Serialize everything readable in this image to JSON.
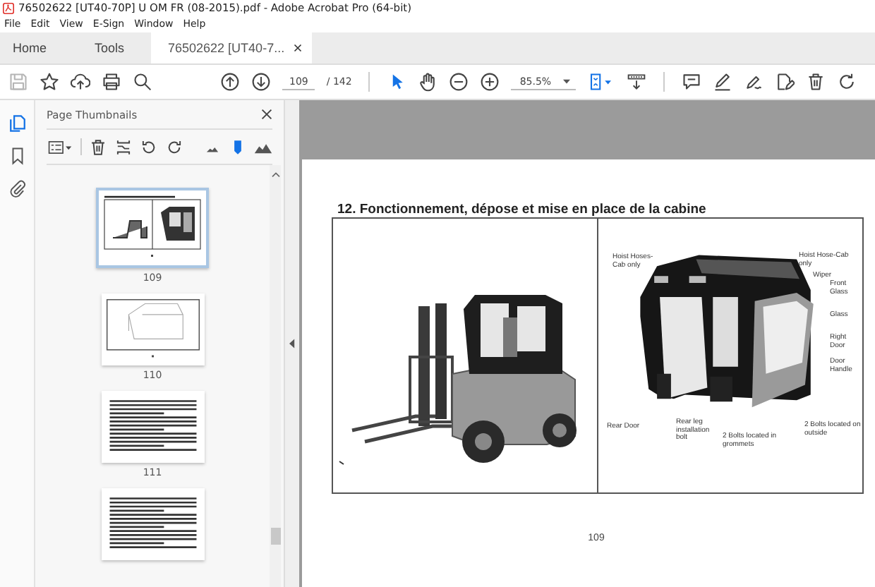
{
  "window": {
    "title": "76502622 [UT40-70P] U OM FR (08-2015).pdf - Adobe Acrobat Pro (64-bit)"
  },
  "menu": [
    "File",
    "Edit",
    "View",
    "E-Sign",
    "Window",
    "Help"
  ],
  "tabs": [
    {
      "label": "Home",
      "selected": false
    },
    {
      "label": "Tools",
      "selected": false
    },
    {
      "label": "76502622 [UT40-7...",
      "selected": true
    }
  ],
  "toolbar": {
    "page": "109",
    "page_count": "/ 142",
    "zoom": "85.5%"
  },
  "thumbnails_panel": {
    "title": "Page Thumbnails",
    "pages": [
      {
        "label": "109",
        "kind": "figure",
        "selected": true
      },
      {
        "label": "110",
        "kind": "diagram",
        "selected": false
      },
      {
        "label": "111",
        "kind": "text",
        "selected": false
      },
      {
        "kind": "text",
        "selected": false
      }
    ]
  },
  "document": {
    "heading": "12. Fonctionnement, dépose et mise en place de la cabine",
    "figure_labels": [
      "Hoist Hoses-Cab only",
      "Hoist Hose-Cab only",
      "Wiper",
      "Front Glass",
      "Glass",
      "Right Door",
      "Door Handle",
      "Rear Door",
      "Rear leg installation bolt",
      "2 Bolts located in grommets",
      "2 Bolts located on outside"
    ],
    "page_number": "109"
  }
}
